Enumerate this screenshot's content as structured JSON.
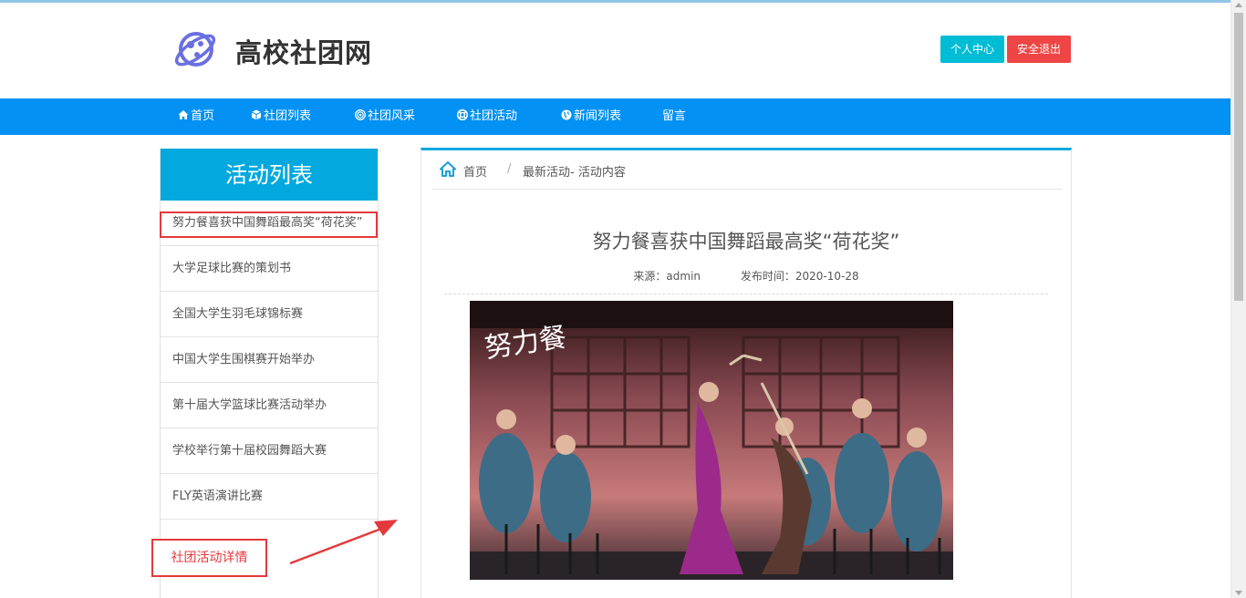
{
  "site": {
    "title": "高校社团网"
  },
  "header": {
    "user_center_label": "个人中心",
    "logout_label": "安全退出",
    "colors": {
      "user_center": "#00bcd4",
      "logout": "#ef4545",
      "nav": "#0391f4"
    }
  },
  "nav": {
    "items": [
      {
        "label": "首页",
        "icon": "home-icon"
      },
      {
        "label": "社团列表",
        "icon": "cube-icon"
      },
      {
        "label": "社团风采",
        "icon": "target-icon"
      },
      {
        "label": "社团活动",
        "icon": "support-icon"
      },
      {
        "label": "新闻列表",
        "icon": "globe-icon"
      },
      {
        "label": "留言",
        "icon": ""
      }
    ]
  },
  "sidebar": {
    "title": "活动列表",
    "items": [
      "努力餐喜获中国舞蹈最高奖“荷花奖”",
      "大学足球比赛的策划书",
      "全国大学生羽毛球锦标赛",
      "中国大学生围棋赛开始举办",
      "第十届大学篮球比赛活动举办",
      "学校举行第十届校园舞蹈大赛",
      "FLY英语演讲比赛"
    ]
  },
  "annotation": {
    "label": "社团活动详情"
  },
  "breadcrumb": {
    "home": "首页",
    "separator": "/",
    "current": "最新活动- 活动内容"
  },
  "article": {
    "title": "努力餐喜获中国舞蹈最高奖“荷花奖”",
    "source": "来源：admin",
    "date": "发布时间：2020-10-28",
    "image_caption": "努力餐"
  }
}
